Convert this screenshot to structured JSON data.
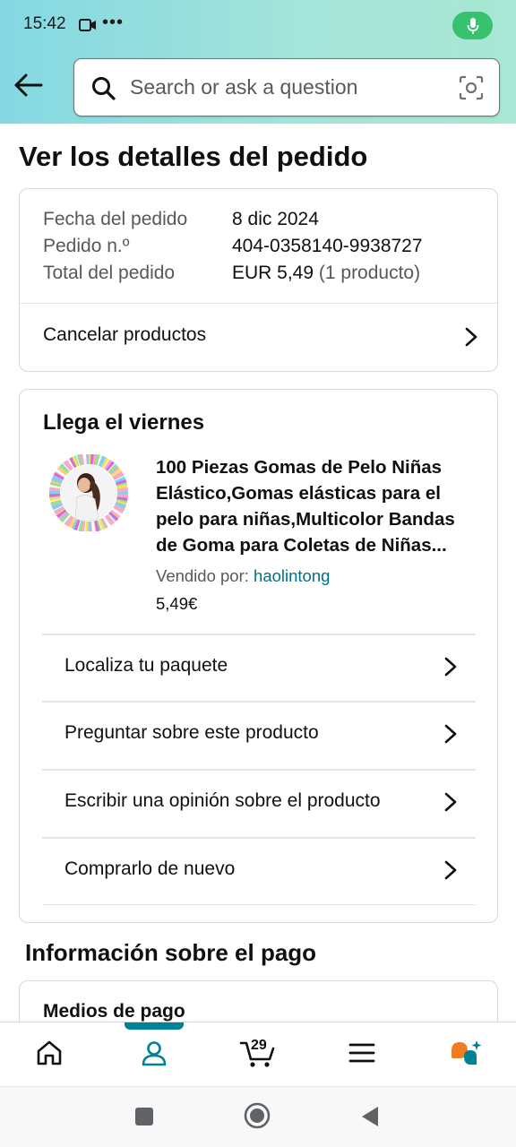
{
  "status_bar": {
    "time": "15:42",
    "dots": "•••",
    "mic_color": "#35c46d"
  },
  "search": {
    "placeholder": "Search or ask a question"
  },
  "page": {
    "title": "Ver los detalles del pedido"
  },
  "order_summary": {
    "rows": [
      {
        "label": "Fecha del pedido",
        "value": "8 dic 2024",
        "sub": ""
      },
      {
        "label": "Pedido n.º",
        "value": "404-0358140-9938727",
        "sub": ""
      },
      {
        "label": "Total del pedido",
        "value": "EUR 5,49",
        "sub": " (1 producto)"
      }
    ],
    "cancel_label": "Cancelar productos"
  },
  "shipment": {
    "arrival": "Llega el viernes",
    "product_title": "100 Piezas Gomas de Pelo Niñas Elástico,Gomas elásticas para el pelo para niñas,Multicolor Bandas de Goma para Coletas de Niñas...",
    "sold_by_label": "Vendido por: ",
    "seller": "haolintong",
    "price": "5,49€",
    "actions": [
      {
        "label": "Localiza tu paquete"
      },
      {
        "label": "Preguntar sobre este producto"
      },
      {
        "label": "Escribir una opinión sobre el producto"
      },
      {
        "label": "Comprarlo de nuevo"
      }
    ]
  },
  "payment": {
    "section_title": "Información sobre el pago",
    "methods_title": "Medios de pago"
  },
  "bottom_nav": {
    "cart_count": "29",
    "items": [
      {
        "icon": "home-icon"
      },
      {
        "icon": "account-icon",
        "active": true
      },
      {
        "icon": "cart-icon"
      },
      {
        "icon": "menu-icon"
      },
      {
        "icon": "rufus-chat-icon"
      }
    ],
    "accent_color": "#008296"
  },
  "colors": {
    "link": "#007185",
    "header_gradient_start": "#84d8e3",
    "header_gradient_end": "#a9e6d3"
  }
}
